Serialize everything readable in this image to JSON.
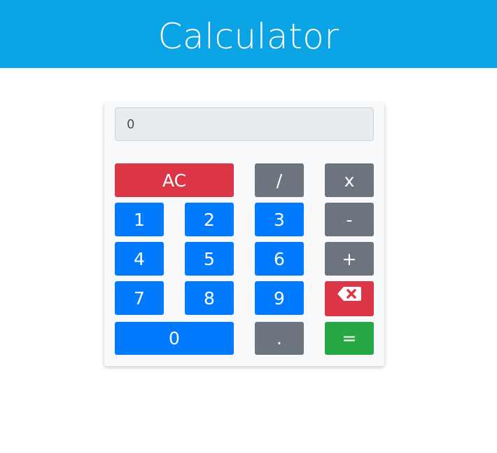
{
  "header": {
    "title": "Calculator"
  },
  "display": {
    "value": "0"
  },
  "keys": {
    "clear": "AC",
    "divide": "/",
    "multiply": "x",
    "subtract": "-",
    "add": "+",
    "equals": "=",
    "decimal": ".",
    "backspace_icon": "backspace-icon",
    "digits": [
      "0",
      "1",
      "2",
      "3",
      "4",
      "5",
      "6",
      "7",
      "8",
      "9"
    ]
  },
  "colors": {
    "header": "#0aa3e4",
    "number_key": "#007bff",
    "operator_key": "#6c757d",
    "danger_key": "#dc3545",
    "equals_key": "#28a745"
  }
}
